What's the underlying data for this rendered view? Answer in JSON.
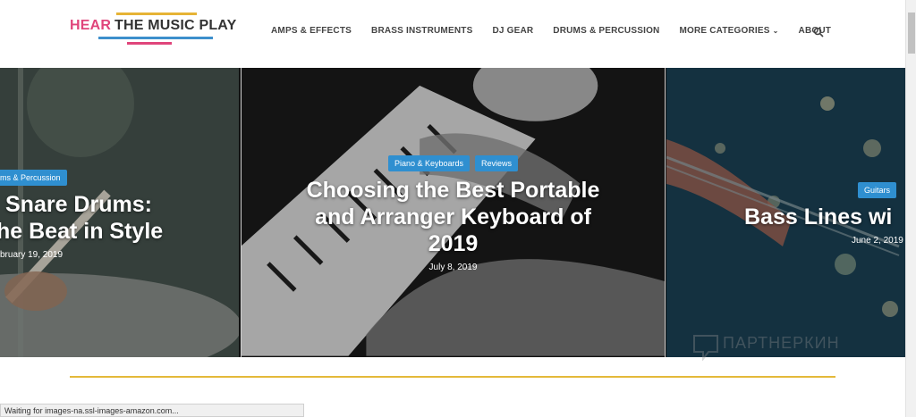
{
  "logo": {
    "word1": "HEAR",
    "word2": "THE MUSIC PLAY"
  },
  "nav": {
    "items": [
      {
        "label": "AMPS & EFFECTS"
      },
      {
        "label": "BRASS INSTRUMENTS"
      },
      {
        "label": "DJ GEAR"
      },
      {
        "label": "DRUMS & PERCUSSION"
      },
      {
        "label": "MORE CATEGORIES"
      },
      {
        "label": "ABOUT"
      }
    ]
  },
  "slides": {
    "left": {
      "tag": "ums & Percussion",
      "title_line1": "Snare Drums:",
      "title_line2": "he Beat in Style",
      "date": "bruary 19, 2019"
    },
    "center": {
      "tag1": "Piano & Keyboards",
      "tag2": "Reviews",
      "title_line1": "Choosing the Best Portable",
      "title_line2": "and Arranger Keyboard of",
      "title_line3": "2019",
      "date": "July 8, 2019"
    },
    "right": {
      "tag": "Guitars",
      "title_line1": "Bass Lines wi",
      "date": "June 2, 2019"
    }
  },
  "watermark": "ПАРТНЕРКИН",
  "status": {
    "text": "Waiting for images-na.ssl-images-amazon.com..."
  },
  "colors": {
    "accent_blue": "#2f8fd0",
    "accent_pink": "#e0457b",
    "accent_gold": "#e4b93a"
  }
}
